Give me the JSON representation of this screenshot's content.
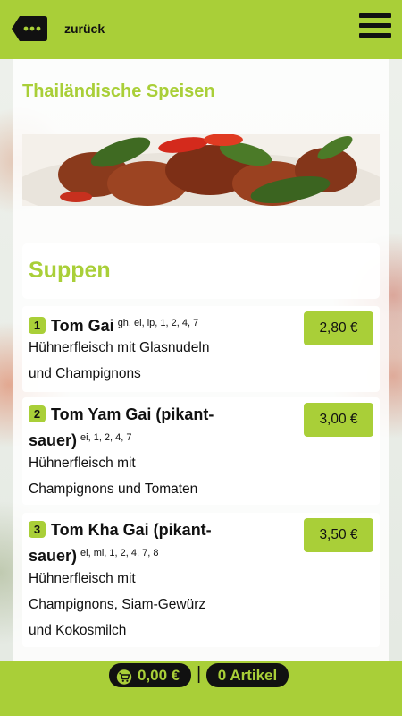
{
  "header": {
    "back_label": "zurück",
    "back_icon": "ellipsis-back-icon",
    "menu_icon": "hamburger-menu-icon"
  },
  "page": {
    "title": "Thailändische Speisen"
  },
  "section": {
    "title": "Suppen"
  },
  "items": [
    {
      "number": "1",
      "name": "Tom Gai",
      "codes": "gh, ei, lp, 1, 2, 4, 7",
      "desc_lines": [
        "Hühnerfleisch mit Glasnudeln",
        "und Champignons"
      ],
      "price": "2,80 €"
    },
    {
      "number": "2",
      "name_lines": [
        "Tom Yam Gai (pikant-",
        "sauer)"
      ],
      "codes": "ei, 1, 2, 4, 7",
      "desc_lines": [
        "Hühnerfleisch mit",
        "Champignons und Tomaten"
      ],
      "price": "3,00 €"
    },
    {
      "number": "3",
      "name_lines": [
        "Tom Kha Gai (pikant-",
        "sauer)"
      ],
      "codes": "ei, mi, 1, 2, 4, 7, 8",
      "desc_lines": [
        "Hühnerfleisch mit",
        "Champignons, Siam-Gewürz",
        "und Kokosmilch"
      ],
      "price": "3,50 €"
    }
  ],
  "footer": {
    "cart_icon": "shopping-cart-icon",
    "cart_total": "0,00 €",
    "separator": "|",
    "articles": "0 Artikel"
  },
  "colors": {
    "accent": "#a9cf38",
    "dark": "#111111"
  }
}
